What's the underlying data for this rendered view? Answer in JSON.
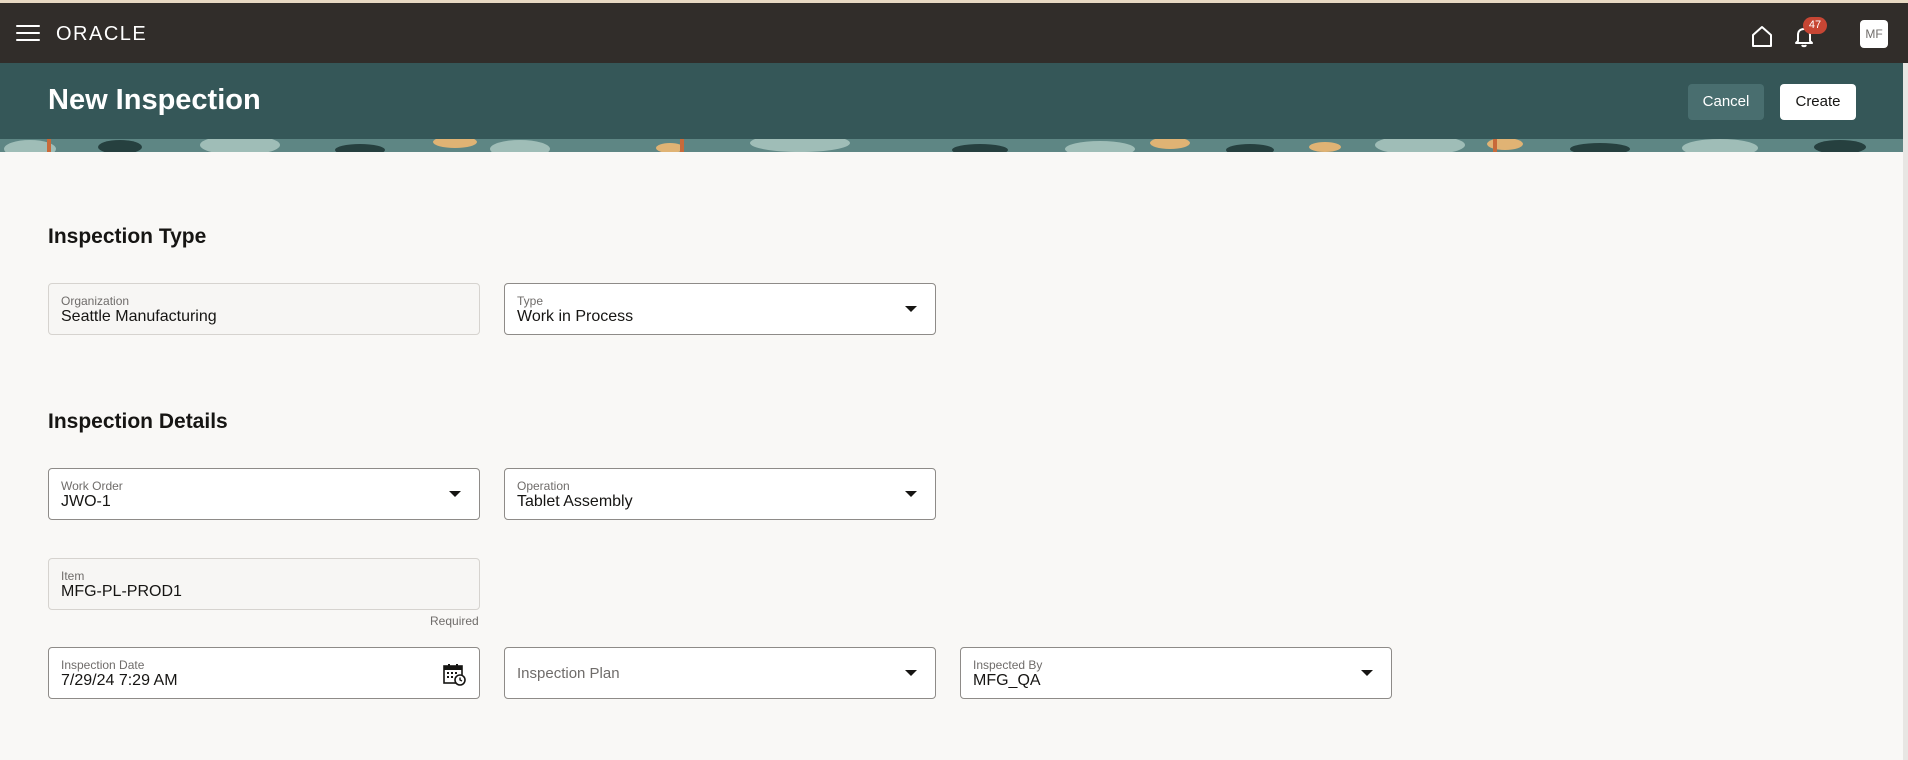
{
  "topbar": {
    "logo": "ORACLE",
    "notifications_count": "47",
    "avatar_initials": "MF",
    "icons": [
      "menu-icon",
      "home-icon",
      "bell-icon"
    ]
  },
  "header": {
    "title": "New Inspection",
    "cancel_label": "Cancel",
    "create_label": "Create"
  },
  "sections": {
    "inspection_type": {
      "title": "Inspection Type",
      "organization": {
        "label": "Organization",
        "value": "Seattle Manufacturing"
      },
      "type": {
        "label": "Type",
        "value": "Work in Process"
      }
    },
    "inspection_details": {
      "title": "Inspection Details",
      "work_order": {
        "label": "Work Order",
        "value": "JWO-1"
      },
      "operation": {
        "label": "Operation",
        "value": "Tablet Assembly"
      },
      "item": {
        "label": "Item",
        "value": "MFG-PL-PROD1",
        "helper": "Required"
      },
      "inspection_date": {
        "label": "Inspection Date",
        "value": "7/29/24 7:29 AM"
      },
      "inspection_plan": {
        "label": "Inspection Plan",
        "value": ""
      },
      "inspected_by": {
        "label": "Inspected By",
        "value": "MFG_QA"
      }
    }
  },
  "colors": {
    "topbar_bg": "#312d2a",
    "header_bg": "#355758",
    "badge_bg": "#c74634",
    "page_bg": "#f9f8f6"
  }
}
